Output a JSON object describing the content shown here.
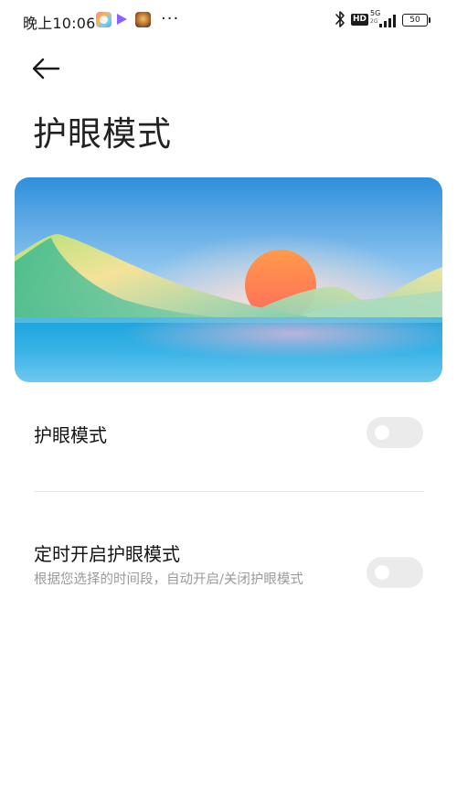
{
  "status_bar": {
    "time": "晚上10:06",
    "more": "···",
    "hd": "HD",
    "network": "5G",
    "network_sub": "2G",
    "battery": "50"
  },
  "header": {
    "back_icon": "arrow-left-icon",
    "title": "护眼模式"
  },
  "hero": {
    "illustration": "sunset-dunes-over-water"
  },
  "settings": {
    "eye_mode": {
      "title": "护眼模式",
      "enabled": false
    },
    "schedule": {
      "title": "定时开启护眼模式",
      "description": "根据您选择的时间段，自动开启/关闭护眼模式",
      "enabled": false
    }
  },
  "colors": {
    "toggle_off": "#ebebeb",
    "desc_text": "#9a9a9a",
    "divider": "#e6e6e6"
  }
}
